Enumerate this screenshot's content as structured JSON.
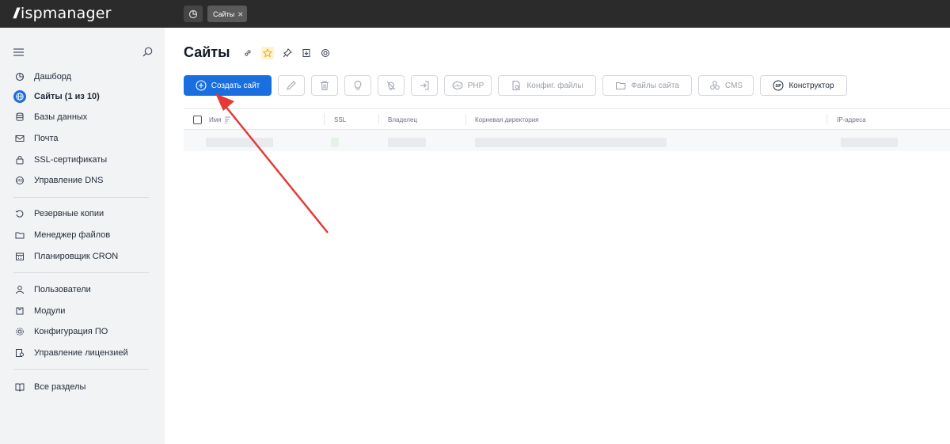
{
  "app": {
    "logo_text": "ispmanager"
  },
  "tabs": [
    {
      "label": "Сайты"
    }
  ],
  "sidebar": {
    "items": [
      {
        "label": "Дашборд",
        "icon": "dashboard-icon"
      },
      {
        "label": "Сайты (1 из 10)",
        "icon": "globe-icon",
        "active": true
      },
      {
        "label": "Базы данных",
        "icon": "database-icon"
      },
      {
        "label": "Почта",
        "icon": "mail-icon"
      },
      {
        "label": "SSL-сертификаты",
        "icon": "certificate-icon"
      },
      {
        "label": "Управление DNS",
        "icon": "dns-icon"
      },
      {
        "label": "Резервные копии",
        "icon": "backup-icon"
      },
      {
        "label": "Менеджер файлов",
        "icon": "folder-icon"
      },
      {
        "label": "Планировщик CRON",
        "icon": "calendar-icon"
      },
      {
        "label": "Пользователи",
        "icon": "user-icon"
      },
      {
        "label": "Модули",
        "icon": "modules-icon"
      },
      {
        "label": "Конфигурация ПО",
        "icon": "gear-icon"
      },
      {
        "label": "Управление лицензией",
        "icon": "license-icon"
      },
      {
        "label": "Все разделы",
        "icon": "book-icon"
      }
    ]
  },
  "page": {
    "title": "Сайты"
  },
  "toolbar": {
    "create_label": "Создать сайт",
    "php_label": "PHP",
    "config_label": "Конфиг. файлы",
    "files_label": "Файлы сайта",
    "cms_label": "CMS",
    "builder_label": "Конструктор"
  },
  "table": {
    "columns": [
      "Имя",
      "SSL",
      "Владелец",
      "Корневая директория",
      "IP-адреса"
    ]
  },
  "colors": {
    "accent": "#1a6fe0",
    "arrow": "#e53935",
    "topbar": "#2b2b2b",
    "sidebar": "#f2f3f5"
  }
}
